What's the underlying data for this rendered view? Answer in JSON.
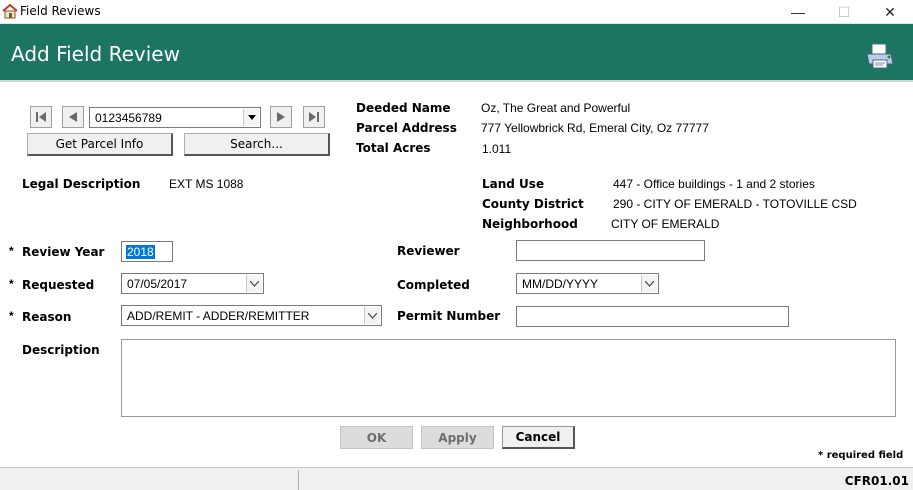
{
  "window": {
    "title": "Field Reviews",
    "minimize": "—",
    "maximize": "☐",
    "close": "✕"
  },
  "header": {
    "heading": "Add Field Review",
    "icon": "printer-icon"
  },
  "nav": {
    "parcel_number": "0123456789",
    "get_parcel_info": "Get Parcel Info",
    "search": "Search..."
  },
  "parcel": {
    "deeded_name_label": "Deeded Name",
    "deeded_name": "Oz, The Great and Powerful",
    "address_label": "Parcel Address",
    "address": "777 Yellowbrick Rd, Emeral City, Oz 77777",
    "acres_label": "Total Acres",
    "acres": "1.011",
    "legal_label": "Legal Description",
    "legal": "EXT  MS 1088",
    "land_use_label": "Land Use",
    "land_use": "447 - Office buildings - 1 and 2 stories",
    "county_district_label": "County District",
    "county_district": "290 -  CITY OF EMERALD - TOTOVILLE CSD",
    "neighborhood_label": "Neighborhood",
    "neighborhood": "CITY OF EMERALD"
  },
  "form": {
    "required_marker": "*",
    "review_year_label": "Review Year",
    "review_year": "2018",
    "requested_label": "Requested",
    "requested": "07/05/2017",
    "reason_label": "Reason",
    "reason": "ADD/REMIT - ADDER/REMITTER",
    "description_label": "Description",
    "reviewer_label": "Reviewer",
    "reviewer": "",
    "completed_label": "Completed",
    "completed": "MM/DD/YYYY",
    "permit_label": "Permit Number",
    "permit": ""
  },
  "actions": {
    "ok": "OK",
    "apply": "Apply",
    "cancel": "Cancel"
  },
  "required_note": "* required field",
  "status": {
    "code": "CFR01.01"
  },
  "colors": {
    "header_bg": "#1c7560",
    "selection": "#0078d7"
  }
}
